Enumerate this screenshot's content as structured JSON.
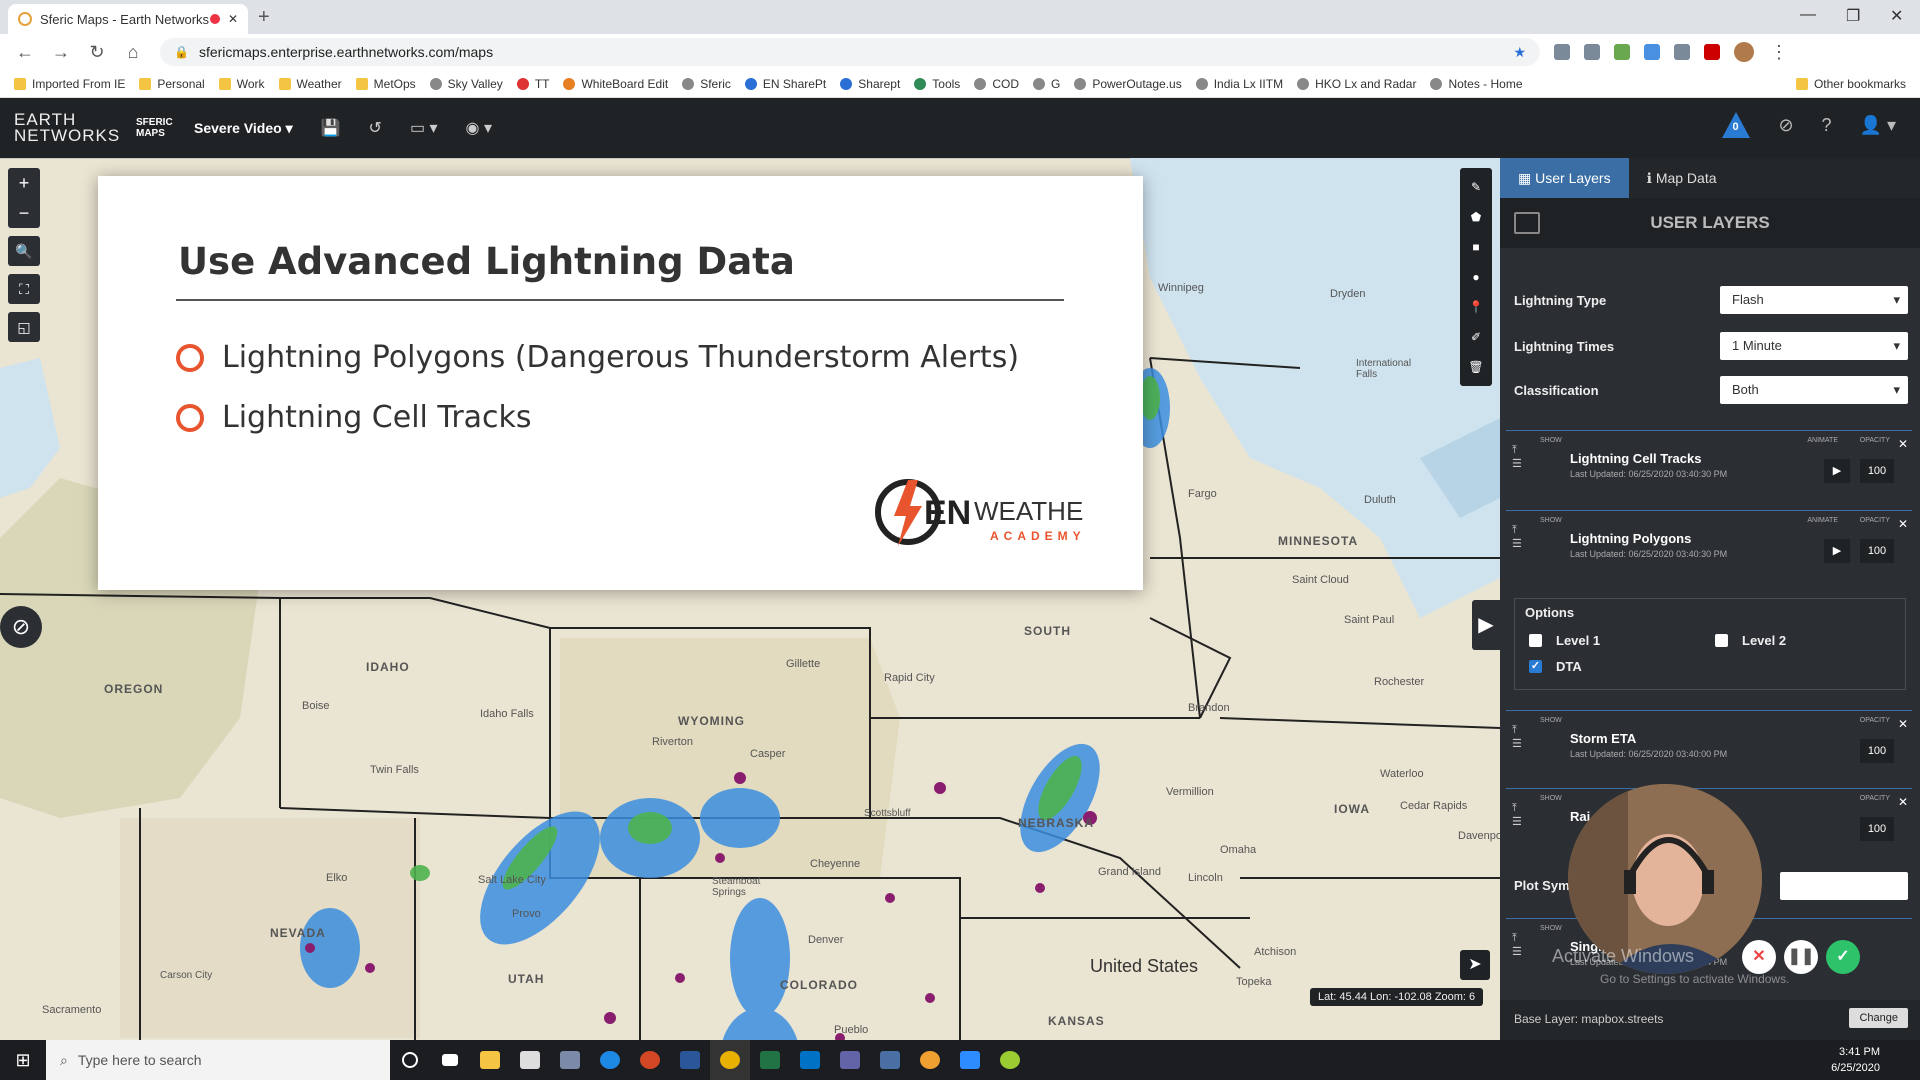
{
  "browser": {
    "tab_title": "Sferic Maps - Earth Networks",
    "url": "sfericmaps.enterprise.earthnetworks.com/maps",
    "bookmarks": [
      "Imported From IE",
      "Personal",
      "Work",
      "Weather",
      "MetOps",
      "Sky Valley",
      "TT",
      "WhiteBoard Edit",
      "Sferic",
      "EN SharePt",
      "Sharept",
      "Tools",
      "COD",
      "G",
      "PowerOutage.us",
      "India Lx IITM",
      "HKO Lx and Radar",
      "Notes - Home"
    ],
    "other_bookmarks": "Other bookmarks"
  },
  "app": {
    "logo": "EARTH NETWORKS",
    "product": "SFERIC MAPS",
    "mode": "Severe Video",
    "alert_count": "0"
  },
  "card": {
    "title": "Use Advanced Lightning Data",
    "bullets": [
      "Lightning Polygons (Dangerous Thunderstorm Alerts)",
      "Lightning Cell Tracks"
    ],
    "logo_en": "EN",
    "logo_weather": "WEATHER",
    "logo_academy": "ACADEMY"
  },
  "map": {
    "labels": [
      "Winnipeg",
      "Dryden",
      "International Falls",
      "Fargo",
      "Duluth",
      "MINNESOTA",
      "Saint Cloud",
      "Saint Paul",
      "Rochester",
      "IDAHO",
      "OREGON",
      "Boise",
      "Idaho Falls",
      "Twin Falls",
      "WYOMING",
      "Riverton",
      "Casper",
      "Gillette",
      "Rapid City",
      "SOUTH",
      "Brandon",
      "Vermillion",
      "NEBRASKA",
      "Scottsbluff",
      "Cheyenne",
      "Grand Island",
      "Lincoln",
      "Omaha",
      "IOWA",
      "Waterloo",
      "Cedar Rapids",
      "Davenport",
      "NEVADA",
      "Elko",
      "Carson City",
      "Sacramento",
      "Salt Lake City",
      "Provo",
      "UTAH",
      "Steamboat Springs",
      "Denver",
      "COLORADO",
      "Pueblo",
      "Atchison",
      "Topeka",
      "KANSAS",
      "United States"
    ],
    "coords": "Lat: 45.44 Lon: -102.08 Zoom: 6"
  },
  "panel": {
    "tabs": [
      "User Layers",
      "Map Data"
    ],
    "header": "USER LAYERS",
    "fields": [
      {
        "label": "Lightning Type",
        "value": "Flash"
      },
      {
        "label": "Lightning Times",
        "value": "1 Minute"
      },
      {
        "label": "Classification",
        "value": "Both"
      }
    ],
    "col_show": "SHOW",
    "col_animate": "ANIMATE",
    "col_opacity": "OPACITY",
    "layers": [
      {
        "name": "Lightning Cell Tracks",
        "updated": "Last Updated: 06/25/2020 03:40:30 PM",
        "opacity": "100"
      },
      {
        "name": "Lightning Polygons",
        "updated": "Last Updated: 06/25/2020 03:40:30 PM",
        "opacity": "100"
      },
      {
        "name": "Storm ETA",
        "updated": "Last Updated: 06/25/2020 03:40:00 PM",
        "opacity": "100"
      },
      {
        "name": "Rai",
        "updated": "",
        "opacity": "100"
      },
      {
        "name": "Single",
        "updated": "Last Updated: 06/25/2020 03:40:04 PM",
        "opacity": ""
      }
    ],
    "options": {
      "title": "Options",
      "level1": "Level 1",
      "level2": "Level 2",
      "dta": "DTA",
      "dta_checked": true
    },
    "plot_sym": "Plot Sym",
    "base_layer": "Base Layer: mapbox.streets",
    "change": "Change",
    "watermark": "Activate Windows",
    "watermark2": "Go to Settings to activate Windows."
  },
  "taskbar": {
    "search_placeholder": "Type here to search",
    "time": "3:41 PM",
    "date": "6/25/2020"
  },
  "colors": {
    "accent": "#3a6ea5",
    "bullet": "#e8542e",
    "header_bg": "#1f2326",
    "panel_bg": "#2b2f33"
  }
}
